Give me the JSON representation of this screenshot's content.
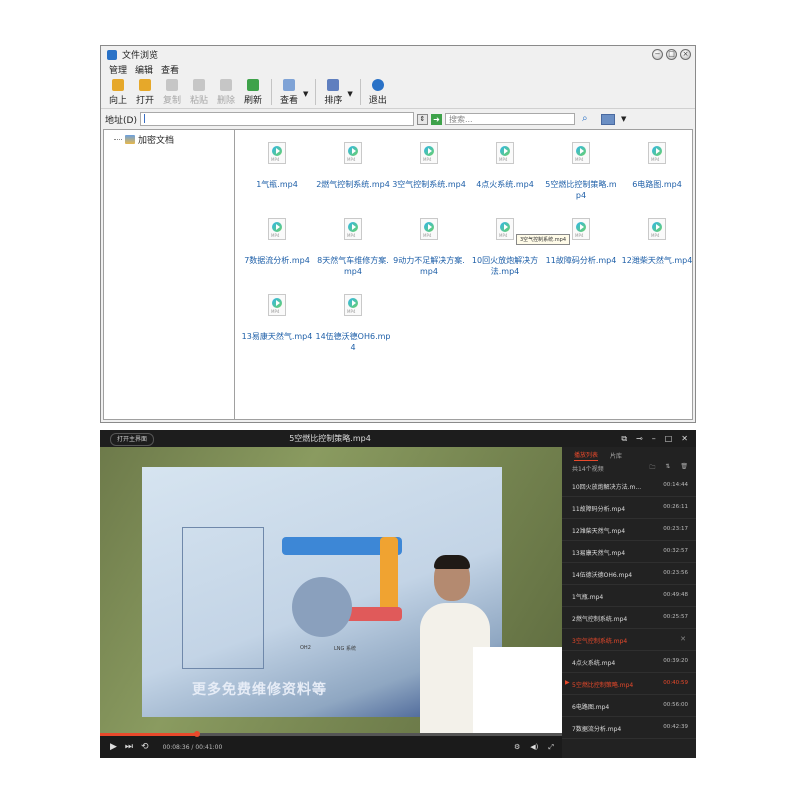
{
  "file_browser": {
    "title": "文件浏览",
    "menu": [
      "管理",
      "编辑",
      "查看"
    ],
    "toolbar": [
      {
        "label": "向上",
        "icon": "up-arrow-icon",
        "color": "#e6a82a",
        "enabled": true
      },
      {
        "label": "打开",
        "icon": "open-folder-icon",
        "color": "#e6a82a",
        "enabled": true
      },
      {
        "label": "复制",
        "icon": "copy-icon",
        "color": "#9e9e9e",
        "enabled": false
      },
      {
        "label": "粘贴",
        "icon": "paste-icon",
        "color": "#9e9e9e",
        "enabled": false
      },
      {
        "label": "删除",
        "icon": "delete-icon",
        "color": "#9e9e9e",
        "enabled": false
      },
      {
        "label": "刷新",
        "icon": "refresh-icon",
        "color": "#3ea24a",
        "enabled": true
      }
    ],
    "view_label": "查看",
    "sort_label": "排序",
    "exit_label": "退出",
    "address_label": "地址(D)",
    "address_value": "",
    "search_placeholder": "搜索...",
    "tree_item": "加密文档",
    "files": [
      {
        "name": "1气瓶.mp4"
      },
      {
        "name": "2燃气控制系统.mp4"
      },
      {
        "name": "3空气控制系统.mp4"
      },
      {
        "name": "4点火系统.mp4"
      },
      {
        "name": "5空燃比控制策略.mp4"
      },
      {
        "name": "6电路图.mp4"
      },
      {
        "name": "7数据流分析.mp4"
      },
      {
        "name": "8天然气车维修方案.mp4"
      },
      {
        "name": "9动力不足解决方案.mp4"
      },
      {
        "name": "10回火放炮解决方法.mp4"
      },
      {
        "name": "11故障码分析.mp4"
      },
      {
        "name": "12潍柴天然气.mp4"
      },
      {
        "name": "13易康天然气.mp4"
      },
      {
        "name": "14伍德沃德OH6.mp4"
      }
    ]
  },
  "player": {
    "home_label": "打开主界面",
    "title": "5空燃比控制策略.mp4",
    "video_banner": "更多免费维修资料等",
    "slide_labels": [
      "OH2",
      "LNG 系统"
    ],
    "time": "00:08:36 / 00:41:00",
    "progress": 0.21,
    "accent_color": "#e8492b",
    "tabs": [
      "播放列表",
      "片库"
    ],
    "count_label": "共14个视频",
    "tooltip": "3空气控制系统.mp4",
    "playlist": [
      {
        "name": "10回火放炮解决方法.m...",
        "duration": "00:14:44",
        "state": ""
      },
      {
        "name": "11故障码分析.mp4",
        "duration": "00:26:11",
        "state": ""
      },
      {
        "name": "12潍柴天然气.mp4",
        "duration": "00:23:17",
        "state": ""
      },
      {
        "name": "13易康天然气.mp4",
        "duration": "00:32:57",
        "state": ""
      },
      {
        "name": "14伍德沃德OH6.mp4",
        "duration": "00:23:56",
        "state": ""
      },
      {
        "name": "1气瓶.mp4",
        "duration": "00:49:48",
        "state": ""
      },
      {
        "name": "2燃气控制系统.mp4",
        "duration": "00:25:57",
        "state": ""
      },
      {
        "name": "3空气控制系统.mp4",
        "duration": "",
        "state": "hover"
      },
      {
        "name": "4点火系统.mp4",
        "duration": "00:39:20",
        "state": ""
      },
      {
        "name": "5空燃比控制策略.mp4",
        "duration": "00:40:59",
        "state": "current"
      },
      {
        "name": "6电路图.mp4",
        "duration": "00:56:00",
        "state": ""
      },
      {
        "name": "7数据流分析.mp4",
        "duration": "00:42:39",
        "state": ""
      }
    ]
  }
}
